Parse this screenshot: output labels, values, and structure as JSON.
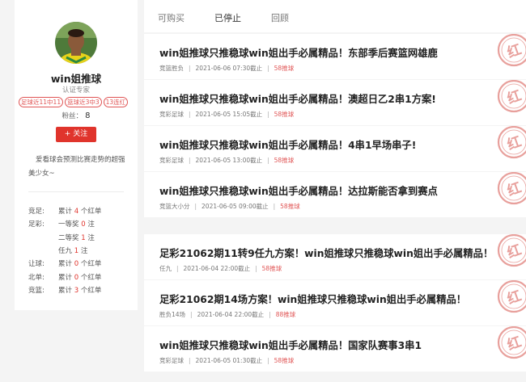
{
  "profile": {
    "name": "win姐推球",
    "role": "认证专家",
    "tags": [
      "足球近11中11",
      "篮球近3中3",
      "13连红"
    ],
    "fans_label": "粉丝：",
    "fans_count": "8",
    "follow_label": "+ 关注",
    "description": "爱看球会预测比赛走势的超强美少女~"
  },
  "stats": [
    {
      "label": "竞足:",
      "pre": "累计",
      "num": "4",
      "post": "个红单"
    },
    {
      "label": "足彩:",
      "pre": "一等奖",
      "num": "0",
      "post": "注"
    },
    {
      "label": "",
      "pre": "二等奖",
      "num": "1",
      "post": "注"
    },
    {
      "label": "",
      "pre": "任九",
      "num": "1",
      "post": "注"
    },
    {
      "label": "让球:",
      "pre": "累计",
      "num": "0",
      "post": "个红单"
    },
    {
      "label": "北单:",
      "pre": "累计",
      "num": "0",
      "post": "个红单"
    },
    {
      "label": "竞篮:",
      "pre": "累计",
      "num": "3",
      "post": "个红单"
    }
  ],
  "tabs": [
    "可购买",
    "已停止",
    "回顾"
  ],
  "articles": [
    {
      "title": "win姐推球只推稳球win姐出手必属精品！东部季后赛篮网雄鹿",
      "category": "竞篮胜负",
      "time": "2021-06-06 07:30截止",
      "price": "58推球"
    },
    {
      "title": "win姐推球只推稳球win姐出手必属精品！澳超日乙2串1方案!",
      "category": "竞彩足球",
      "time": "2021-06-05 15:05截止",
      "price": "58推球"
    },
    {
      "title": "win姐推球只推稳球win姐出手必属精品！4串1早场串子!",
      "category": "竞彩足球",
      "time": "2021-06-05 13:00截止",
      "price": "58推球"
    },
    {
      "title": "win姐推球只推稳球win姐出手必属精品！达拉斯能否拿到赛点",
      "category": "竞篮大小分",
      "time": "2021-06-05 09:00截止",
      "price": "58推球"
    },
    {
      "title": "足彩21062期11转9任九方案！win姐推球只推稳球win姐出手必属精品！",
      "category": "任九",
      "time": "2021-06-04 22:00截止",
      "price": "58推球"
    },
    {
      "title": "足彩21062期14场方案！win姐推球只推稳球win姐出手必属精品！",
      "category": "胜负14场",
      "time": "2021-06-04 22:00截止",
      "price": "88推球"
    },
    {
      "title": "win姐推球只推稳球win姐出手必属精品！国家队赛事3串1",
      "category": "竞彩足球",
      "time": "2021-06-05 01:30截止",
      "price": "58推球"
    }
  ],
  "stamp_text": "红",
  "colors": {
    "accent": "#e0342c",
    "stamp": "#e8a09c"
  }
}
